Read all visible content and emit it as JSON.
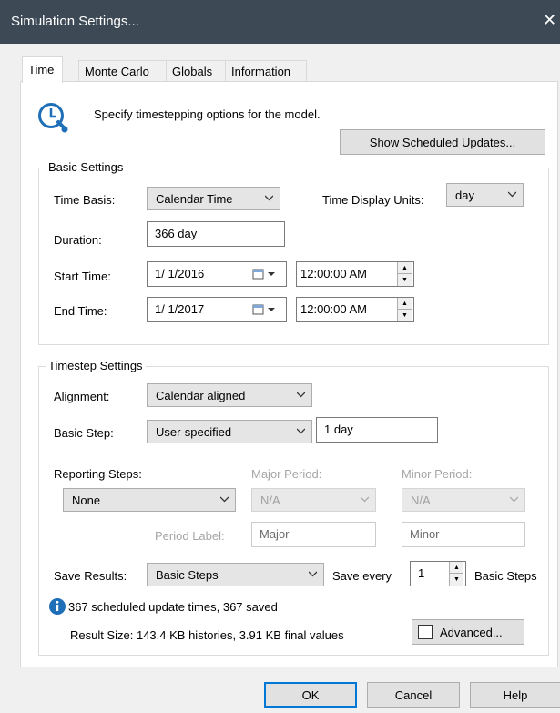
{
  "window": {
    "title": "Simulation Settings...",
    "close_glyph": "✕"
  },
  "tabs": [
    "Time",
    "Monte Carlo",
    "Globals",
    "Information"
  ],
  "header": {
    "description": "Specify timestepping options for the model.",
    "show_updates_label": "Show Scheduled Updates..."
  },
  "basic": {
    "legend": "Basic Settings",
    "time_basis_label": "Time Basis:",
    "time_basis_value": "Calendar Time",
    "display_units_label": "Time Display Units:",
    "display_units_value": "day",
    "duration_label": "Duration:",
    "duration_value": "366 day",
    "start_label": "Start Time:",
    "start_date": "1/  1/2016",
    "start_time": "12:00:00 AM",
    "end_label": "End Time:",
    "end_date": "1/  1/2017",
    "end_time": "12:00:00 AM"
  },
  "timestep": {
    "legend": "Timestep Settings",
    "alignment_label": "Alignment:",
    "alignment_value": "Calendar aligned",
    "basic_step_label": "Basic Step:",
    "basic_step_value": "User-specified",
    "basic_step_amount": "1 day",
    "reporting_label": "Reporting Steps:",
    "reporting_value": "None",
    "major_label": "Major Period:",
    "major_value": "N/A",
    "minor_label": "Minor Period:",
    "minor_value": "N/A",
    "period_label": "Period Label:",
    "period_major": "Major",
    "period_minor": "Minor",
    "save_results_label": "Save Results:",
    "save_results_value": "Basic Steps",
    "save_every_label": "Save every",
    "save_every_value": "1",
    "save_every_unit": "Basic Steps",
    "info_text": "367 scheduled update times, 367 saved",
    "result_size": "Result Size: 143.4 KB histories, 3.91 KB final values",
    "advanced_label": "Advanced..."
  },
  "footer": {
    "ok": "OK",
    "cancel": "Cancel",
    "help": "Help"
  },
  "colors": {
    "titlebar": "#3d4a56",
    "accent": "#0078d7",
    "icon_blue": "#1e6fb8"
  }
}
